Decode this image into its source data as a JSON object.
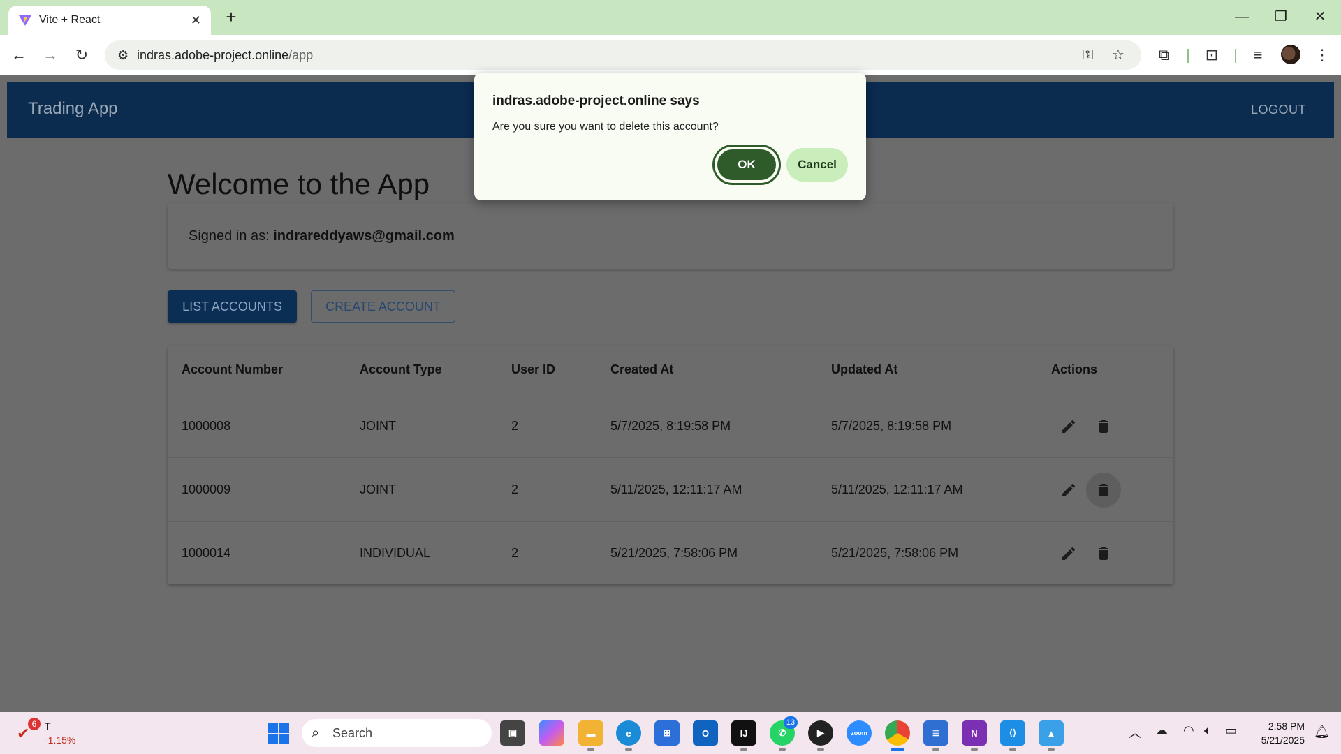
{
  "browser": {
    "tab_title": "Vite + React",
    "url_host": "indras.adobe-project.online",
    "url_path": "/app"
  },
  "app": {
    "brand": "Trading App",
    "logout_label": "LOGOUT",
    "welcome": "Welcome to the App",
    "signed_in_label": "Signed in as: ",
    "signed_in_email": "indrareddyaws@gmail.com",
    "list_accounts_label": "LIST ACCOUNTS",
    "create_account_label": "CREATE ACCOUNT"
  },
  "table": {
    "headers": [
      "Account Number",
      "Account Type",
      "User ID",
      "Created At",
      "Updated At",
      "Actions"
    ],
    "rows": [
      [
        "1000008",
        "JOINT",
        "2",
        "5/7/2025, 8:19:58 PM",
        "5/7/2025, 8:19:58 PM"
      ],
      [
        "1000009",
        "JOINT",
        "2",
        "5/11/2025, 12:11:17 AM",
        "5/11/2025, 12:11:17 AM"
      ],
      [
        "1000014",
        "INDIVIDUAL",
        "2",
        "5/21/2025, 7:58:06 PM",
        "5/21/2025, 7:58:06 PM"
      ]
    ]
  },
  "dialog": {
    "origin": "indras.adobe-project.online says",
    "message": "Are you sure you want to delete this account?",
    "ok_label": "OK",
    "cancel_label": "Cancel"
  },
  "taskbar": {
    "stock_badge": "6",
    "stock_symbol": "T",
    "stock_change": "-1.15%",
    "search_label": "Search",
    "whatsapp_badge": "13",
    "time": "2:58 PM",
    "date": "5/21/2025"
  },
  "colors": {
    "appbar": "#0b2b4f",
    "dialog_ok": "#2f5a2a",
    "dialog_cancel": "#c9edbb",
    "tabbar": "#c8e6c0"
  }
}
